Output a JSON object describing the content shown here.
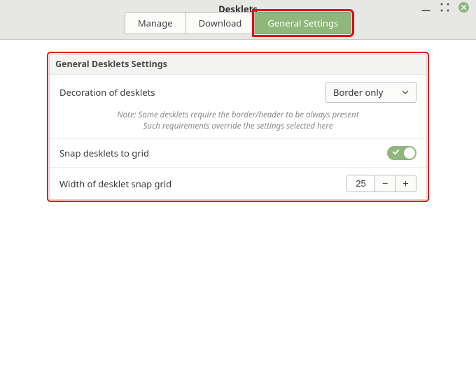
{
  "window": {
    "title": "Desklets"
  },
  "tabs": {
    "manage": {
      "label": "Manage"
    },
    "download": {
      "label": "Download"
    },
    "general": {
      "label": "General Settings"
    }
  },
  "panel": {
    "title": "General Desklets Settings",
    "decoration": {
      "label": "Decoration of desklets",
      "selected": "Border only"
    },
    "note_line1": "Note: Some desklets require the border/header to be always present",
    "note_line2": "Such requirements override the settings selected here",
    "snap_to_grid": {
      "label": "Snap desklets to grid",
      "value": true
    },
    "grid_width": {
      "label": "Width of desklet snap grid",
      "value": "25",
      "minus": "−",
      "plus": "+"
    }
  }
}
